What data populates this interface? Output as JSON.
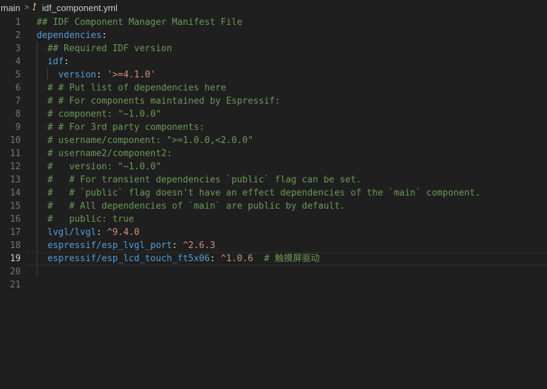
{
  "breadcrumb": {
    "folder": "main",
    "separator": ">",
    "file_icon": "!",
    "file": "idf_component.yml"
  },
  "editor": {
    "current_line": 19,
    "lines": [
      {
        "n": "1",
        "indent": "",
        "tokens": [
          {
            "t": "c",
            "v": "## IDF Component Manager Manifest File"
          }
        ]
      },
      {
        "n": "2",
        "indent": "",
        "tokens": [
          {
            "t": "k",
            "v": "dependencies"
          },
          {
            "t": "p",
            "v": ":"
          }
        ]
      },
      {
        "n": "3",
        "indent": "  ",
        "tokens": [
          {
            "t": "c",
            "v": "## Required IDF version"
          }
        ]
      },
      {
        "n": "4",
        "indent": "  ",
        "tokens": [
          {
            "t": "k",
            "v": "idf"
          },
          {
            "t": "p",
            "v": ":"
          }
        ]
      },
      {
        "n": "5",
        "indent": "    ",
        "tokens": [
          {
            "t": "k",
            "v": "version"
          },
          {
            "t": "p",
            "v": ": "
          },
          {
            "t": "s",
            "v": "'>=4.1.0'"
          }
        ]
      },
      {
        "n": "6",
        "indent": "  ",
        "tokens": [
          {
            "t": "c",
            "v": "# # Put list of dependencies here"
          }
        ]
      },
      {
        "n": "7",
        "indent": "  ",
        "tokens": [
          {
            "t": "c",
            "v": "# # For components maintained by Espressif:"
          }
        ]
      },
      {
        "n": "8",
        "indent": "  ",
        "tokens": [
          {
            "t": "c",
            "v": "# component: \"~1.0.0\""
          }
        ]
      },
      {
        "n": "9",
        "indent": "  ",
        "tokens": [
          {
            "t": "c",
            "v": "# # For 3rd party components:"
          }
        ]
      },
      {
        "n": "10",
        "indent": "  ",
        "tokens": [
          {
            "t": "c",
            "v": "# username/component: \">=1.0.0,<2.0.0\""
          }
        ]
      },
      {
        "n": "11",
        "indent": "  ",
        "tokens": [
          {
            "t": "c",
            "v": "# username2/component2:"
          }
        ]
      },
      {
        "n": "12",
        "indent": "  ",
        "tokens": [
          {
            "t": "c",
            "v": "#   version: \"~1.0.0\""
          }
        ]
      },
      {
        "n": "13",
        "indent": "  ",
        "tokens": [
          {
            "t": "c",
            "v": "#   # For transient dependencies `public` flag can be set."
          }
        ]
      },
      {
        "n": "14",
        "indent": "  ",
        "tokens": [
          {
            "t": "c",
            "v": "#   # `public` flag doesn't have an effect dependencies of the `main` component."
          }
        ]
      },
      {
        "n": "15",
        "indent": "  ",
        "tokens": [
          {
            "t": "c",
            "v": "#   # All dependencies of `main` are public by default."
          }
        ]
      },
      {
        "n": "16",
        "indent": "  ",
        "tokens": [
          {
            "t": "c",
            "v": "#   public: true"
          }
        ]
      },
      {
        "n": "17",
        "indent": "  ",
        "tokens": [
          {
            "t": "k",
            "v": "lvgl/lvgl"
          },
          {
            "t": "p",
            "v": ": "
          },
          {
            "t": "s",
            "v": "^9.4.0"
          }
        ]
      },
      {
        "n": "18",
        "indent": "  ",
        "tokens": [
          {
            "t": "k",
            "v": "espressif/esp_lvgl_port"
          },
          {
            "t": "p",
            "v": ": "
          },
          {
            "t": "s",
            "v": "^2.6.3"
          }
        ]
      },
      {
        "n": "19",
        "indent": "  ",
        "tokens": [
          {
            "t": "k",
            "v": "espressif/esp_lcd_touch_ft5x06"
          },
          {
            "t": "p",
            "v": ": "
          },
          {
            "t": "s",
            "v": "^1.0.6"
          },
          {
            "t": "p",
            "v": "  "
          },
          {
            "t": "c",
            "v": "# 触摸屏驱动"
          }
        ]
      },
      {
        "n": "20",
        "indent": "",
        "tokens": []
      },
      {
        "n": "21",
        "indent": "",
        "tokens": []
      }
    ]
  }
}
